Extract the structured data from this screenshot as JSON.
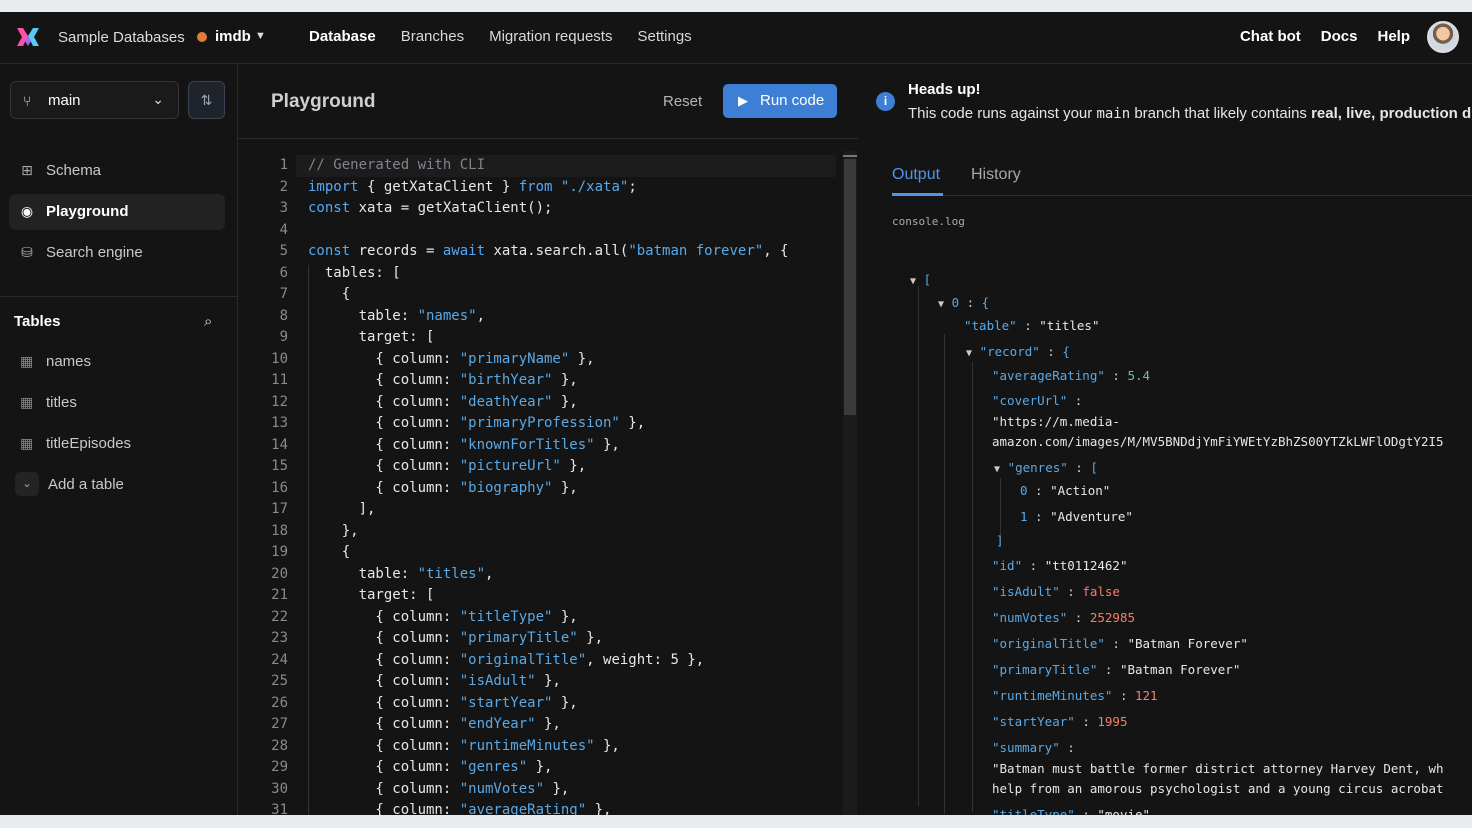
{
  "topbar": {
    "workspace": "Sample Databases",
    "database": "imdb",
    "nav": [
      "Database",
      "Branches",
      "Migration requests",
      "Settings"
    ],
    "links": [
      "Chat bot",
      "Docs",
      "Help"
    ],
    "colors": {
      "accent": "#3e7fd6",
      "db_dot": "#e07b39"
    }
  },
  "sidebar": {
    "branch": "main",
    "menu": [
      "Schema",
      "Playground",
      "Search engine"
    ],
    "tables_heading": "Tables",
    "tables": [
      "names",
      "titles",
      "titleEpisodes"
    ],
    "add_table": "Add a table"
  },
  "playground": {
    "title": "Playground",
    "reset": "Reset",
    "run": "Run code"
  },
  "code": {
    "line_numbers": [
      "1",
      "2",
      "3",
      "4",
      "5",
      "6",
      "7",
      "8",
      "9",
      "10",
      "11",
      "12",
      "13",
      "14",
      "15",
      "16",
      "17",
      "18",
      "19",
      "20",
      "21",
      "22",
      "23",
      "24",
      "25",
      "26",
      "27",
      "28",
      "29",
      "30",
      "31"
    ],
    "lines": [
      "// Generated with CLI",
      "import { getXataClient } from \"./xata\";",
      "const xata = getXataClient();",
      "",
      "const records = await xata.search.all(\"batman forever\", {",
      "  tables: [",
      "    {",
      "      table: \"names\",",
      "      target: [",
      "        { column: \"primaryName\" },",
      "        { column: \"birthYear\" },",
      "        { column: \"deathYear\" },",
      "        { column: \"primaryProfession\" },",
      "        { column: \"knownForTitles\" },",
      "        { column: \"pictureUrl\" },",
      "        { column: \"biography\" },",
      "      ],",
      "    },",
      "    {",
      "      table: \"titles\",",
      "      target: [",
      "        { column: \"titleType\" },",
      "        { column: \"primaryTitle\" },",
      "        { column: \"originalTitle\", weight: 5 },",
      "        { column: \"isAdult\" },",
      "        { column: \"startYear\" },",
      "        { column: \"endYear\" },",
      "        { column: \"runtimeMinutes\" },",
      "        { column: \"genres\" },",
      "        { column: \"numVotes\" },",
      "        { column: \"averageRating\" },"
    ]
  },
  "notice": {
    "title": "Heads up!",
    "text_before": "This code runs against your ",
    "branch": "main",
    "text_middle": " branch that likely contains ",
    "text_bold": "real, live, production d"
  },
  "output": {
    "tabs": [
      "Output",
      "History"
    ],
    "console_label": "console.log",
    "open_bracket": "[",
    "item_index": "0",
    "brace": "{",
    "table_key": "\"table\"",
    "table_val": "\"titles\"",
    "record_key": "\"record\"",
    "averageRating_key": "\"averageRating\"",
    "averageRating_val": "5.4",
    "coverUrl_key": "\"coverUrl\"",
    "coverUrl_val1": "\"https://m.media-",
    "coverUrl_val2": "amazon.com/images/M/MV5BNDdjYmFiYWEtYzBhZS00YTZkLWFlODgtY2I5",
    "genres_key": "\"genres\"",
    "genre0_idx": "0",
    "genre0_val": "\"Action\"",
    "genre1_idx": "1",
    "genre1_val": "\"Adventure\"",
    "close_bracket": "]",
    "id_key": "\"id\"",
    "id_val": "\"tt0112462\"",
    "isAdult_key": "\"isAdult\"",
    "isAdult_val": "false",
    "numVotes_key": "\"numVotes\"",
    "numVotes_val": "252985",
    "originalTitle_key": "\"originalTitle\"",
    "originalTitle_val": "\"Batman Forever\"",
    "primaryTitle_key": "\"primaryTitle\"",
    "primaryTitle_val": "\"Batman Forever\"",
    "runtimeMinutes_key": "\"runtimeMinutes\"",
    "runtimeMinutes_val": "121",
    "startYear_key": "\"startYear\"",
    "startYear_val": "1995",
    "summary_key": "\"summary\"",
    "summary_val1": "\"Batman must battle former district attorney Harvey Dent, wh",
    "summary_val2": "help from an amorous psychologist and a young circus acrobat",
    "titleType_key": "\"titleType\"",
    "titleType_val": "\"movie\""
  }
}
